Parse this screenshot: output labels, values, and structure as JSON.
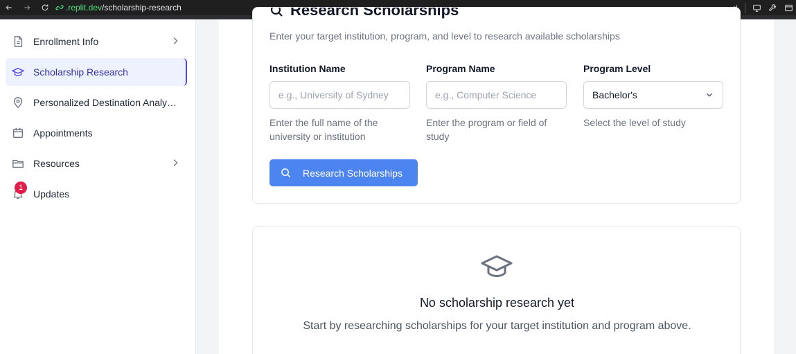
{
  "browser": {
    "url_host": ".replit.dev",
    "url_path": "/scholarship-research"
  },
  "sidebar": {
    "items": [
      {
        "label": "Enrollment Info",
        "icon": "document-icon",
        "has_chevron": true
      },
      {
        "label": "Scholarship Research",
        "icon": "graduation-cap-icon",
        "active": true
      },
      {
        "label": "Personalized Destination Analysis",
        "icon": "map-pin-icon"
      },
      {
        "label": "Appointments",
        "icon": "calendar-icon"
      },
      {
        "label": "Resources",
        "icon": "folder-icon",
        "has_chevron": true
      },
      {
        "label": "Updates",
        "icon": "bell-icon",
        "badge": "1"
      }
    ]
  },
  "research": {
    "title": "Research Scholarships",
    "subtitle": "Enter your target institution, program, and level to research available scholarships",
    "institution": {
      "label": "Institution Name",
      "placeholder": "e.g., University of Sydney",
      "help": "Enter the full name of the university or institution"
    },
    "program": {
      "label": "Program Name",
      "placeholder": "e.g., Computer Science",
      "help": "Enter the program or field of study"
    },
    "level": {
      "label": "Program Level",
      "value": "Bachelor's",
      "help": "Select the level of study"
    },
    "button_label": "Research Scholarships"
  },
  "empty_state": {
    "title": "No scholarship research yet",
    "text": "Start by researching scholarships for your target institution and program above."
  },
  "colors": {
    "accent": "#4c84f0",
    "active_bg": "#eef2ff",
    "active_text": "#3730a3",
    "badge": "#e11d48"
  }
}
